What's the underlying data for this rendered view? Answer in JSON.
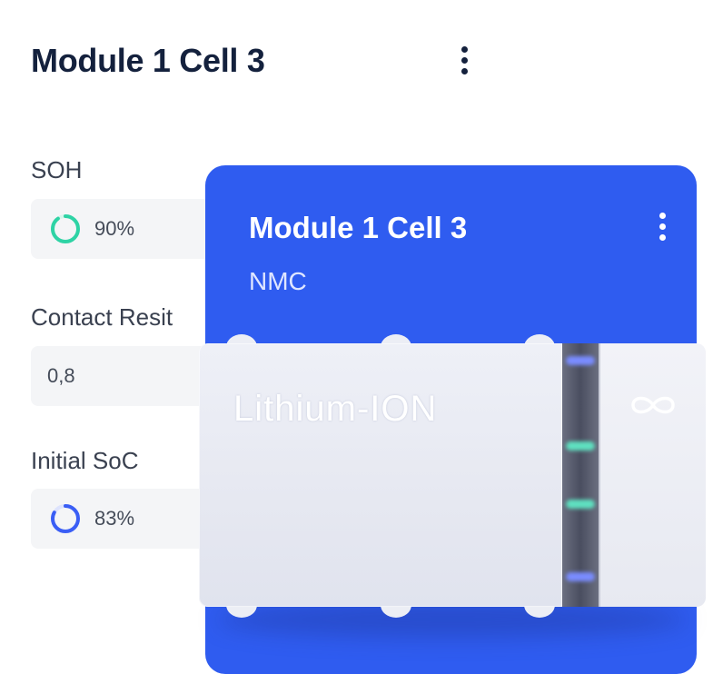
{
  "header": {
    "title": "Module 1 Cell 3",
    "menu_icon": "more-vertical-icon"
  },
  "fields": {
    "soh": {
      "label": "SOH",
      "value": "90%",
      "ring_percent": 90,
      "ring_color": "#2ed3a5"
    },
    "contact_resistance": {
      "label": "Contact Resit",
      "value": "0,8"
    },
    "initial_soc": {
      "label": "Initial SoC",
      "value": "83%",
      "ring_percent": 83,
      "ring_color": "#3a5ef5"
    }
  },
  "card": {
    "title": "Module 1 Cell 3",
    "subtitle": "NMC",
    "menu_icon": "more-vertical-icon",
    "color": "#2f5cf0"
  },
  "battery": {
    "label": "Lithium-ION",
    "cap_icon": "infinity-icon"
  }
}
